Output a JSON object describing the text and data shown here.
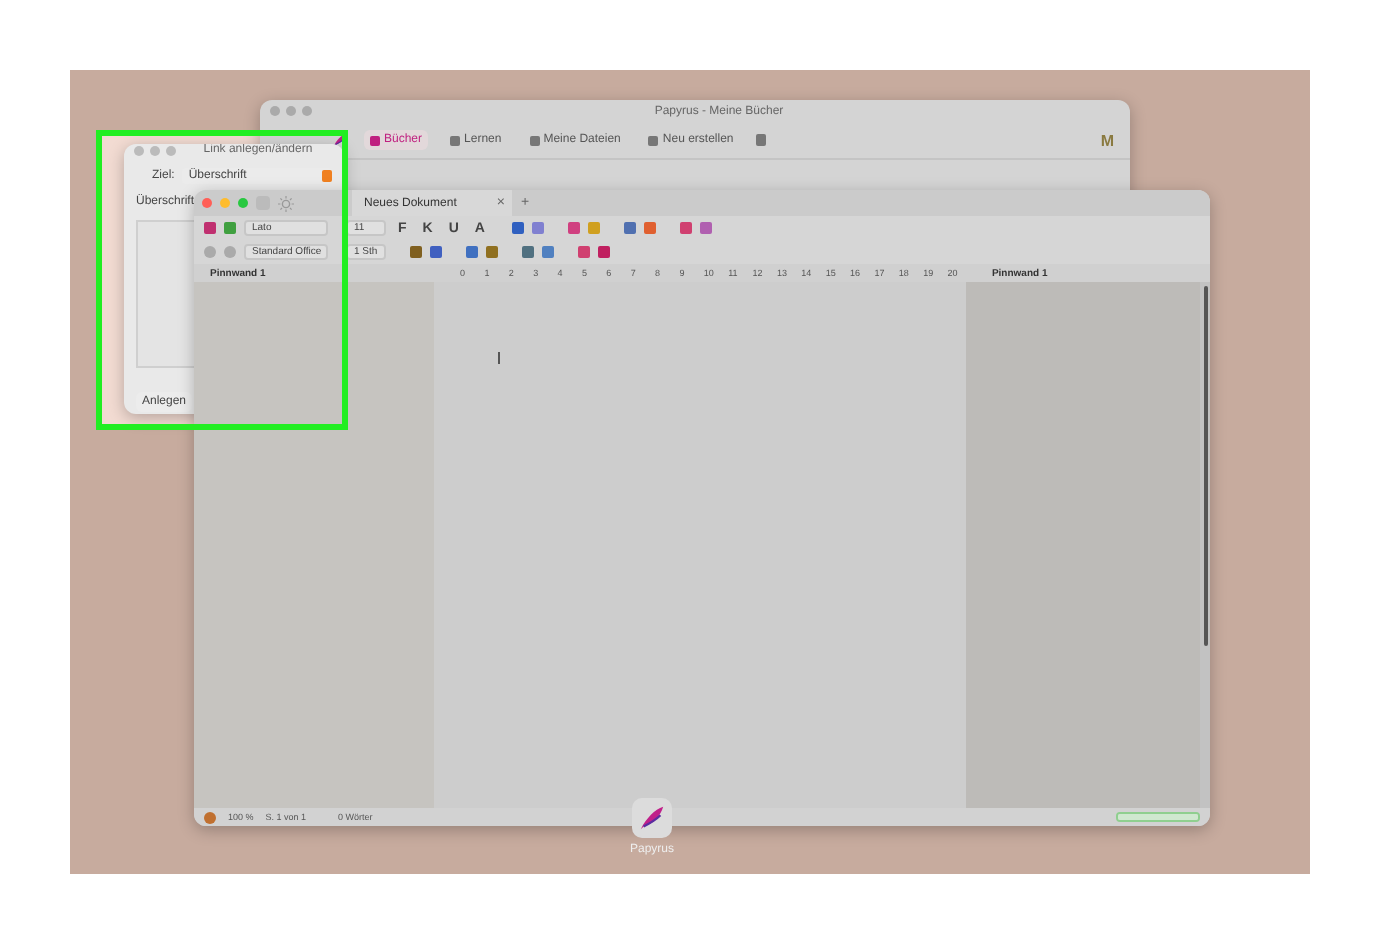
{
  "back_window": {
    "title": "Papyrus - Meine Bücher",
    "toolbar": [
      {
        "label": "Bücher",
        "selected": true
      },
      {
        "label": "Lernen",
        "selected": false
      },
      {
        "label": "Meine Dateien",
        "selected": false
      },
      {
        "label": "Neu erstellen",
        "selected": false
      }
    ],
    "avatar": "M"
  },
  "dialog": {
    "title": "Link anlegen/ändern",
    "target_label": "Ziel:",
    "target_value": "Überschrift",
    "list_label": "Überschrift",
    "button": "Anlegen"
  },
  "document_window": {
    "tab": "Neues Dokument",
    "close": "×",
    "new_tab": "+",
    "font": "Lato",
    "font_size": "11",
    "style": "Standard Office",
    "line_spacing": "1 Sth",
    "format_buttons": [
      "F",
      "K",
      "U",
      "A"
    ],
    "ruler": [
      "0",
      "1",
      "2",
      "3",
      "4",
      "5",
      "6",
      "7",
      "8",
      "9",
      "10",
      "11",
      "12",
      "13",
      "14",
      "15",
      "16",
      "17",
      "18",
      "19",
      "20"
    ],
    "pinboard_left": "Pinnwand 1",
    "pinboard_right": "Pinnwand 1",
    "status": {
      "zoom": "100 %",
      "page": "S. 1 von 1",
      "words": "0 Wörter",
      "progress": {
        "level": 1
      }
    }
  },
  "dock": {
    "label": "Papyrus"
  }
}
